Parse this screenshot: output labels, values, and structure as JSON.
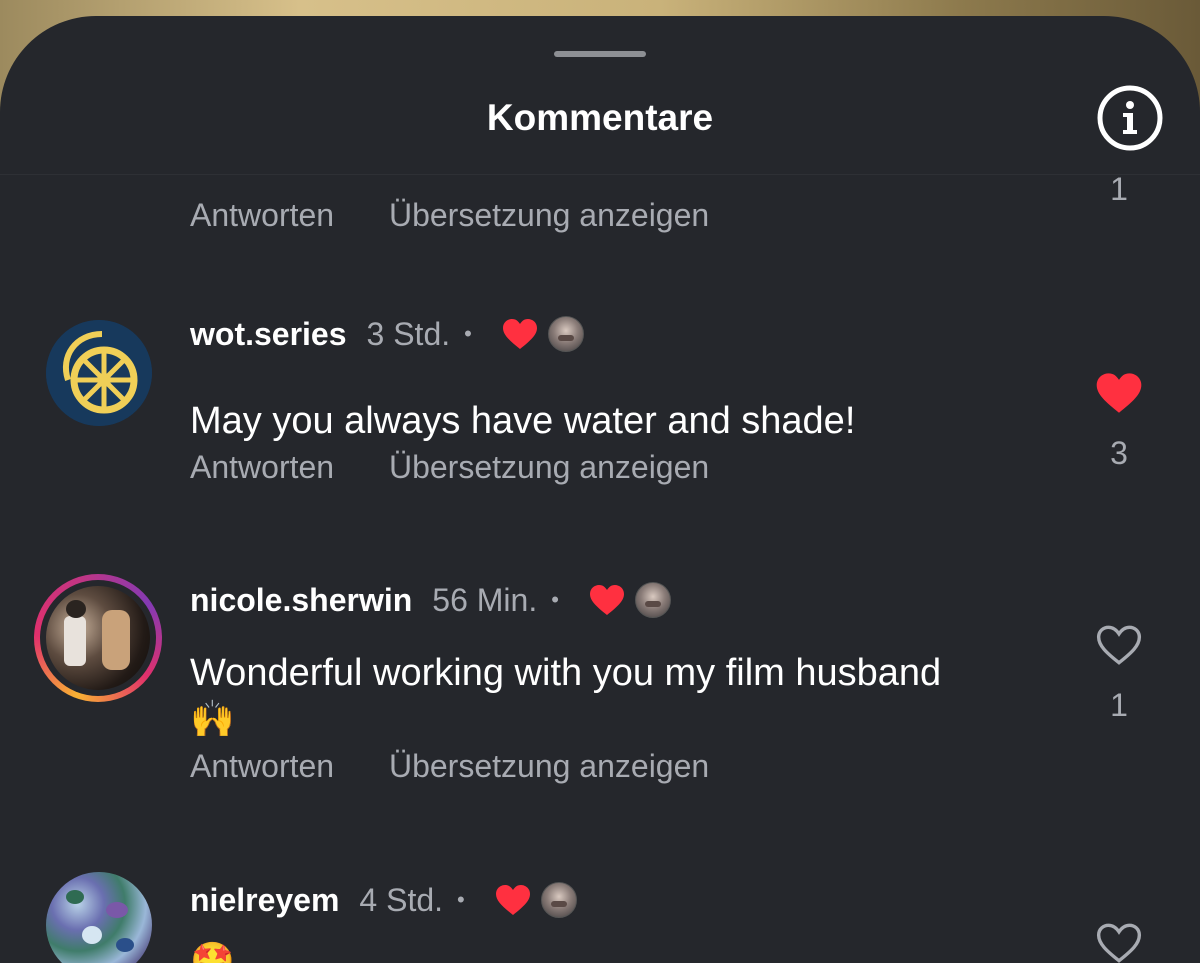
{
  "header": {
    "title": "Kommentare",
    "info_icon": "info-icon"
  },
  "actions": {
    "reply_label": "Antworten",
    "translate_label": "Übersetzung anzeigen"
  },
  "top_partial": {
    "like_count": "1"
  },
  "comments": [
    {
      "username": "wot.series",
      "time": "3 Std.",
      "separator": "•",
      "author_liked": true,
      "text": "May you always have water and shade!",
      "liked": true,
      "like_count": "3"
    },
    {
      "username": "nicole.sherwin",
      "time": "56 Min.",
      "separator": "•",
      "author_liked": true,
      "text": "Wonderful working with you my film husband",
      "emoji": "🙌",
      "liked": false,
      "like_count": "1"
    },
    {
      "username": "nielreyem",
      "time": "4 Std.",
      "separator": "•",
      "author_liked": true,
      "emoji": "🤩",
      "liked": false
    }
  ],
  "colors": {
    "background": "#25272c",
    "heart_red": "#ff3040",
    "muted_text": "#a8abb2",
    "primary_text": "#ffffff"
  }
}
